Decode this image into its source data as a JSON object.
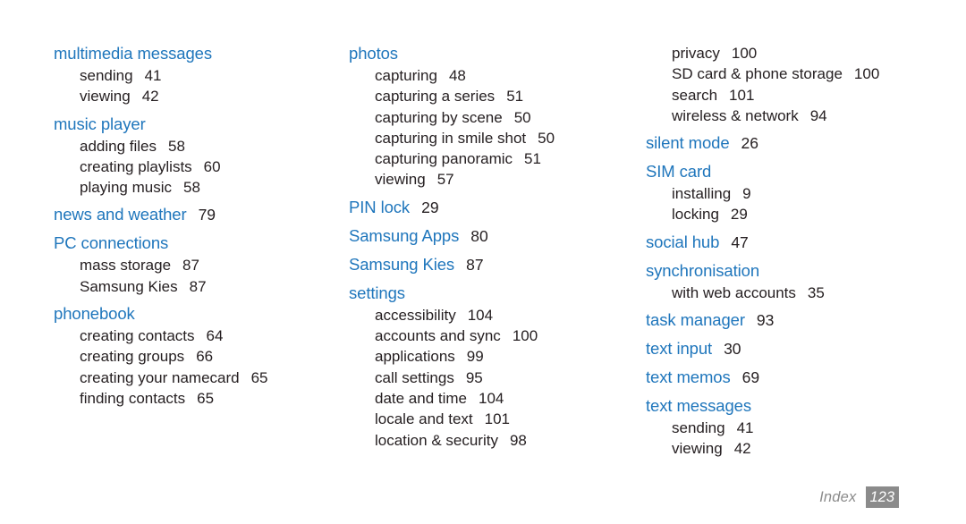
{
  "page": {
    "type": "index",
    "footer_label": "Index",
    "footer_page_number": "123",
    "heading_color": "#1f76bc",
    "body_color": "#262022",
    "footer_color": "#8b8b8b",
    "background_color": "#ffffff"
  },
  "columns": [
    {
      "groups": [
        {
          "heading": "multimedia messages",
          "heading_page": "",
          "entries": [
            {
              "label": "sending",
              "page": "41"
            },
            {
              "label": "viewing",
              "page": "42"
            }
          ]
        },
        {
          "heading": "music player",
          "heading_page": "",
          "entries": [
            {
              "label": "adding files",
              "page": "58"
            },
            {
              "label": "creating playlists",
              "page": "60"
            },
            {
              "label": "playing music",
              "page": "58"
            }
          ]
        },
        {
          "heading": "news and weather",
          "heading_page": "79",
          "entries": []
        },
        {
          "heading": "PC connections",
          "heading_page": "",
          "entries": [
            {
              "label": "mass storage",
              "page": "87"
            },
            {
              "label": "Samsung Kies",
              "page": "87"
            }
          ]
        },
        {
          "heading": "phonebook",
          "heading_page": "",
          "entries": [
            {
              "label": "creating contacts",
              "page": "64"
            },
            {
              "label": "creating groups",
              "page": "66"
            },
            {
              "label": "creating your namecard",
              "page": "65"
            },
            {
              "label": "finding contacts",
              "page": "65"
            }
          ]
        }
      ]
    },
    {
      "groups": [
        {
          "heading": "photos",
          "heading_page": "",
          "entries": [
            {
              "label": "capturing",
              "page": "48"
            },
            {
              "label": "capturing a series",
              "page": "51"
            },
            {
              "label": "capturing by scene",
              "page": "50"
            },
            {
              "label": "capturing in smile shot",
              "page": "50"
            },
            {
              "label": "capturing panoramic",
              "page": "51"
            },
            {
              "label": "viewing",
              "page": "57"
            }
          ]
        },
        {
          "heading": "PIN lock",
          "heading_page": "29",
          "entries": []
        },
        {
          "heading": "Samsung Apps",
          "heading_page": "80",
          "entries": []
        },
        {
          "heading": "Samsung Kies",
          "heading_page": "87",
          "entries": []
        },
        {
          "heading": "settings",
          "heading_page": "",
          "entries": [
            {
              "label": "accessibility",
              "page": "104"
            },
            {
              "label": "accounts and sync",
              "page": "100"
            },
            {
              "label": "applications",
              "page": "99"
            },
            {
              "label": "call settings",
              "page": "95"
            },
            {
              "label": "date and time",
              "page": "104"
            },
            {
              "label": "locale and text",
              "page": "101"
            },
            {
              "label": "location & security",
              "page": "98"
            }
          ]
        }
      ]
    },
    {
      "groups": [
        {
          "heading": "",
          "heading_page": "",
          "continued": true,
          "entries": [
            {
              "label": "privacy",
              "page": "100"
            },
            {
              "label": "SD card & phone storage",
              "page": "100"
            },
            {
              "label": "search",
              "page": "101"
            },
            {
              "label": "wireless & network",
              "page": "94"
            }
          ]
        },
        {
          "heading": "silent mode",
          "heading_page": "26",
          "entries": []
        },
        {
          "heading": "SIM card",
          "heading_page": "",
          "entries": [
            {
              "label": "installing",
              "page": "9"
            },
            {
              "label": "locking",
              "page": "29"
            }
          ]
        },
        {
          "heading": "social hub",
          "heading_page": "47",
          "entries": []
        },
        {
          "heading": "synchronisation",
          "heading_page": "",
          "entries": [
            {
              "label": "with web accounts",
              "page": "35"
            }
          ]
        },
        {
          "heading": "task manager",
          "heading_page": "93",
          "entries": []
        },
        {
          "heading": "text input",
          "heading_page": "30",
          "entries": []
        },
        {
          "heading": "text memos",
          "heading_page": "69",
          "entries": []
        },
        {
          "heading": "text messages",
          "heading_page": "",
          "entries": [
            {
              "label": "sending",
              "page": "41"
            },
            {
              "label": "viewing",
              "page": "42"
            }
          ]
        }
      ]
    }
  ]
}
